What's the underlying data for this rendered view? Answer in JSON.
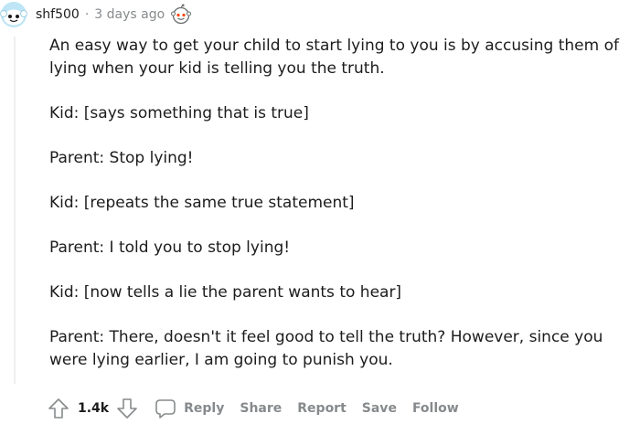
{
  "comment": {
    "author": "shf500",
    "separator": "·",
    "time": "3 days ago",
    "avatar_icon": "snoo-avatar-icon",
    "award_icon": "award-icon",
    "paragraphs": [
      "An easy way to get your child to start lying to you is by accusing them of lying when your kid is telling you the truth.",
      "Kid: [says something that is true]",
      "Parent: Stop lying!",
      "Kid: [repeats the same true statement]",
      "Parent: I told you to stop lying!",
      "Kid: [now tells a lie the parent wants to hear]",
      "Parent: There, doesn't it feel good to tell the truth? However, since you were lying earlier, I am going to punish you."
    ]
  },
  "actions": {
    "upvote_icon": "upvote-icon",
    "score": "1.4k",
    "downvote_icon": "downvote-icon",
    "reply_icon": "chat-bubble-icon",
    "reply": "Reply",
    "share": "Share",
    "report": "Report",
    "save": "Save",
    "follow": "Follow"
  },
  "colors": {
    "text": "#1c1c1c",
    "meta": "#878a8c",
    "avatar_bg": "#46d160",
    "thread_line": "#edeff1"
  }
}
